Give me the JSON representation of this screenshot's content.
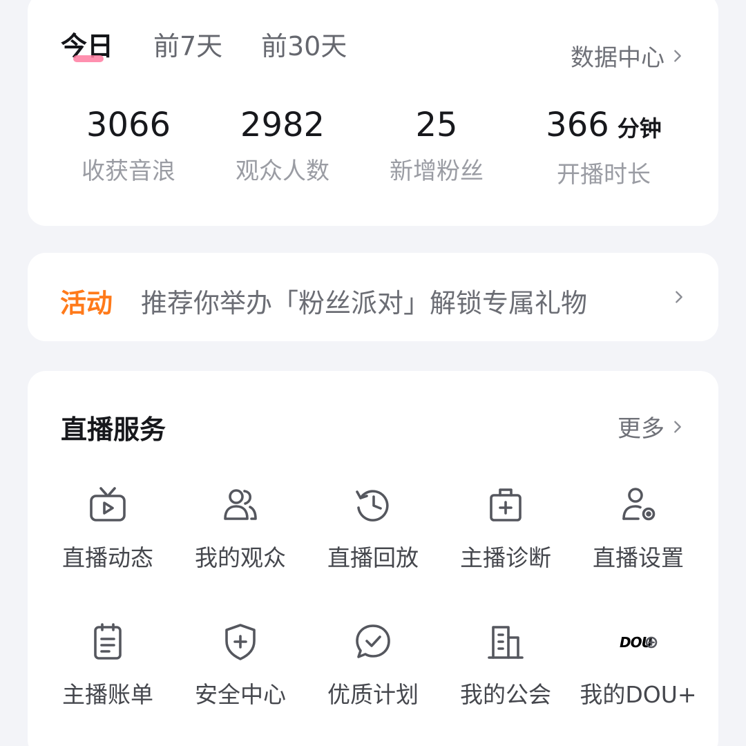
{
  "stats": {
    "tabs": [
      {
        "label": "今日",
        "active": true
      },
      {
        "label": "前7天",
        "active": false
      },
      {
        "label": "前30天",
        "active": false
      }
    ],
    "data_center_label": "数据中心",
    "items": [
      {
        "value": "3066",
        "unit": "",
        "label": "收获音浪"
      },
      {
        "value": "2982",
        "unit": "",
        "label": "观众人数"
      },
      {
        "value": "25",
        "unit": "",
        "label": "新增粉丝"
      },
      {
        "value": "366",
        "unit": "分钟",
        "label": "开播时长"
      }
    ]
  },
  "activity": {
    "tag": "活动",
    "text": "推荐你举办「粉丝派对」解锁专属礼物"
  },
  "services": {
    "title": "直播服务",
    "more_label": "更多",
    "dou_mark": "DOU",
    "items": [
      {
        "label": "直播动态",
        "icon": "tv-icon"
      },
      {
        "label": "我的观众",
        "icon": "audience-icon"
      },
      {
        "label": "直播回放",
        "icon": "replay-clock-icon"
      },
      {
        "label": "主播诊断",
        "icon": "medical-kit-icon"
      },
      {
        "label": "直播设置",
        "icon": "user-settings-icon"
      },
      {
        "label": "主播账单",
        "icon": "bill-icon"
      },
      {
        "label": "安全中心",
        "icon": "shield-plus-icon"
      },
      {
        "label": "优质计划",
        "icon": "check-bubble-icon"
      },
      {
        "label": "我的公会",
        "icon": "building-icon"
      },
      {
        "label": "我的DOU+",
        "icon": "dou-plus-icon"
      }
    ]
  },
  "colors": {
    "accent_orange": "#ff7a1a",
    "tab_underline": "#ff7da1",
    "background": "#f3f4f8"
  }
}
